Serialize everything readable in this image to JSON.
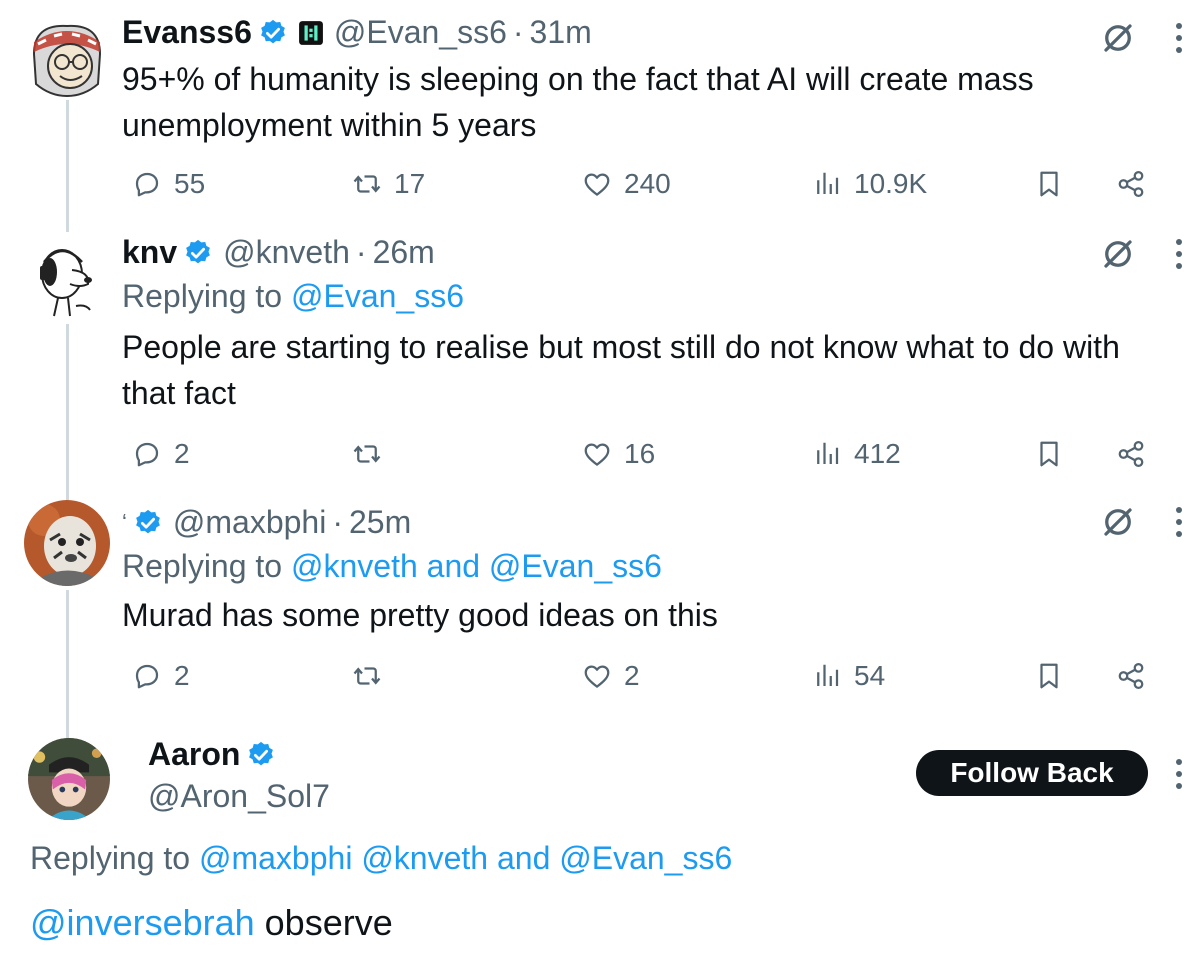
{
  "tweets": [
    {
      "name": "Evanss6",
      "handle": "@Evan_ss6",
      "separator": "·",
      "time": "31m",
      "text": "95+% of humanity is sleeping on the fact that AI will create mass unemployment within 5 years",
      "replying_prefix": "",
      "replying_to": "",
      "stats": {
        "replies": "55",
        "retweets": "17",
        "likes": "240",
        "views": "10.9K"
      }
    },
    {
      "name": "knv",
      "handle": "@knveth",
      "separator": "·",
      "time": "26m",
      "replying_prefix": "Replying to",
      "replying_to": "@Evan_ss6",
      "text": "People are starting to realise but most still do not know what to do with that fact",
      "stats": {
        "replies": "2",
        "retweets": "",
        "likes": "16",
        "views": "412"
      }
    },
    {
      "name": "ʻ",
      "handle": "@maxbphi",
      "separator": "·",
      "time": "25m",
      "replying_prefix": "Replying to",
      "replying_to": "@knveth and @Evan_ss6",
      "text": "Murad has some pretty good ideas on this",
      "stats": {
        "replies": "2",
        "retweets": "",
        "likes": "2",
        "views": "54"
      }
    }
  ],
  "focused": {
    "name": "Aaron",
    "handle": "@Aron_Sol7",
    "follow_label": "Follow Back",
    "replying_prefix": "Replying to",
    "replying_to": "@maxbphi @knveth and @Evan_ss6",
    "mention": "@inversebrah",
    "text": " observe"
  },
  "colors": {
    "link": "#1d9bf0",
    "secondary_text": "#536471",
    "primary_text": "#0f1419",
    "thread_line": "#cfd9de",
    "verified": "#1d9bf0"
  },
  "icons": [
    "verified-badge-icon",
    "grok-icon",
    "more-options-icon",
    "reply-icon",
    "retweet-icon",
    "like-icon",
    "views-icon",
    "bookmark-icon",
    "share-icon"
  ]
}
